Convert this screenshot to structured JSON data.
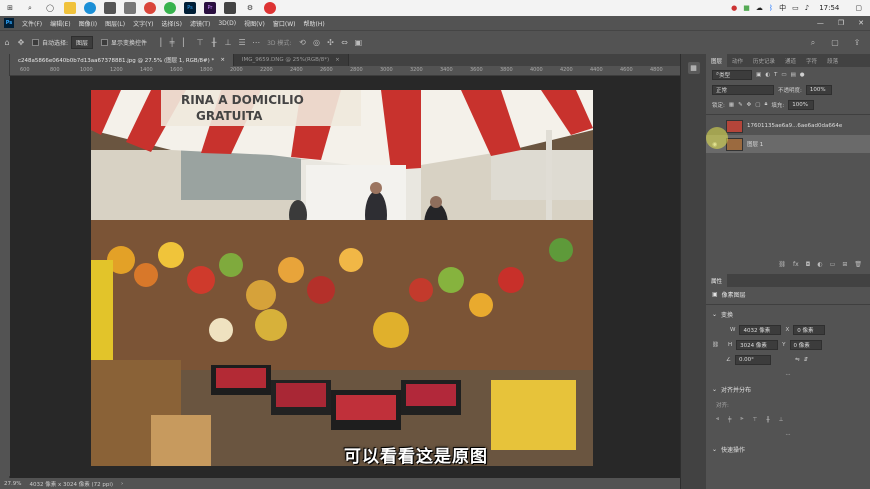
{
  "taskbar": {
    "icons": [
      "windows-start",
      "search",
      "task-view",
      "file-explorer",
      "edge",
      "store",
      "mail",
      "chrome",
      "wechat",
      "photoshop",
      "premiere",
      "audition",
      "settings",
      "recorder"
    ],
    "time": "17:54"
  },
  "menubar": {
    "items": [
      "文件(F)",
      "编辑(E)",
      "图像(I)",
      "图层(L)",
      "文字(Y)",
      "选择(S)",
      "滤镜(T)",
      "3D(D)",
      "视图(V)",
      "窗口(W)",
      "帮助(H)"
    ]
  },
  "options": {
    "auto_select_label": "自动选择:",
    "auto_select_value": "图层",
    "show_transform_label": "显示变换控件",
    "mode_label": "3D 模式:"
  },
  "tabs": [
    {
      "label": "c248a5866e0640b0b7d13aa67378881.jpg @ 27.5% (图层 1, RGB/8#) *",
      "active": true
    },
    {
      "label": "IMG_9659.DNG @ 25%(RGB/8*)",
      "active": false
    }
  ],
  "ruler_ticks": [
    "600",
    "800",
    "1000",
    "1200",
    "1400",
    "1600",
    "1800",
    "2000",
    "2200",
    "2400",
    "2600",
    "2800",
    "3000",
    "3200",
    "3400",
    "3600",
    "3800",
    "4000",
    "4200",
    "4400",
    "4600",
    "4800"
  ],
  "photo": {
    "awning_text": "RINA A DOMICILIO",
    "awning_text2": "GRATUITA"
  },
  "subtitle": "可以看看这是原图",
  "status": {
    "zoom": "27.9%",
    "doc_size": "4032 像素 x 3024 像素 (72 ppi)"
  },
  "layers_panel": {
    "tabs": [
      "图层",
      "动作",
      "历史记录",
      "通道",
      "字符",
      "段落"
    ],
    "filter_label": "类型",
    "blend_mode": "正常",
    "opacity_label": "不透明度:",
    "opacity_value": "100%",
    "lock_label": "锁定:",
    "fill_label": "填充:",
    "fill_value": "100%",
    "layers": [
      {
        "name": "17601135ae6a9...6ae6ad0da664e",
        "visible": false,
        "selected": false
      },
      {
        "name": "图层 1",
        "visible": true,
        "selected": true
      }
    ]
  },
  "properties_panel": {
    "title": "属性",
    "kind": "像素图层",
    "transform_title": "变换",
    "w_label": "W",
    "w_value": "4032 像素",
    "x_label": "X",
    "x_value": "0 像素",
    "h_label": "H",
    "h_value": "3024 像素",
    "y_label": "Y",
    "y_value": "0 像素",
    "angle_value": "0.00°",
    "align_title": "对齐并分布",
    "align_label": "对齐:",
    "quick_title": "快速操作"
  },
  "colors": {
    "ps_dark": "#535353",
    "ps_darker": "#424242",
    "canvas_bg": "#282828",
    "awning_red": "#c8322d"
  }
}
